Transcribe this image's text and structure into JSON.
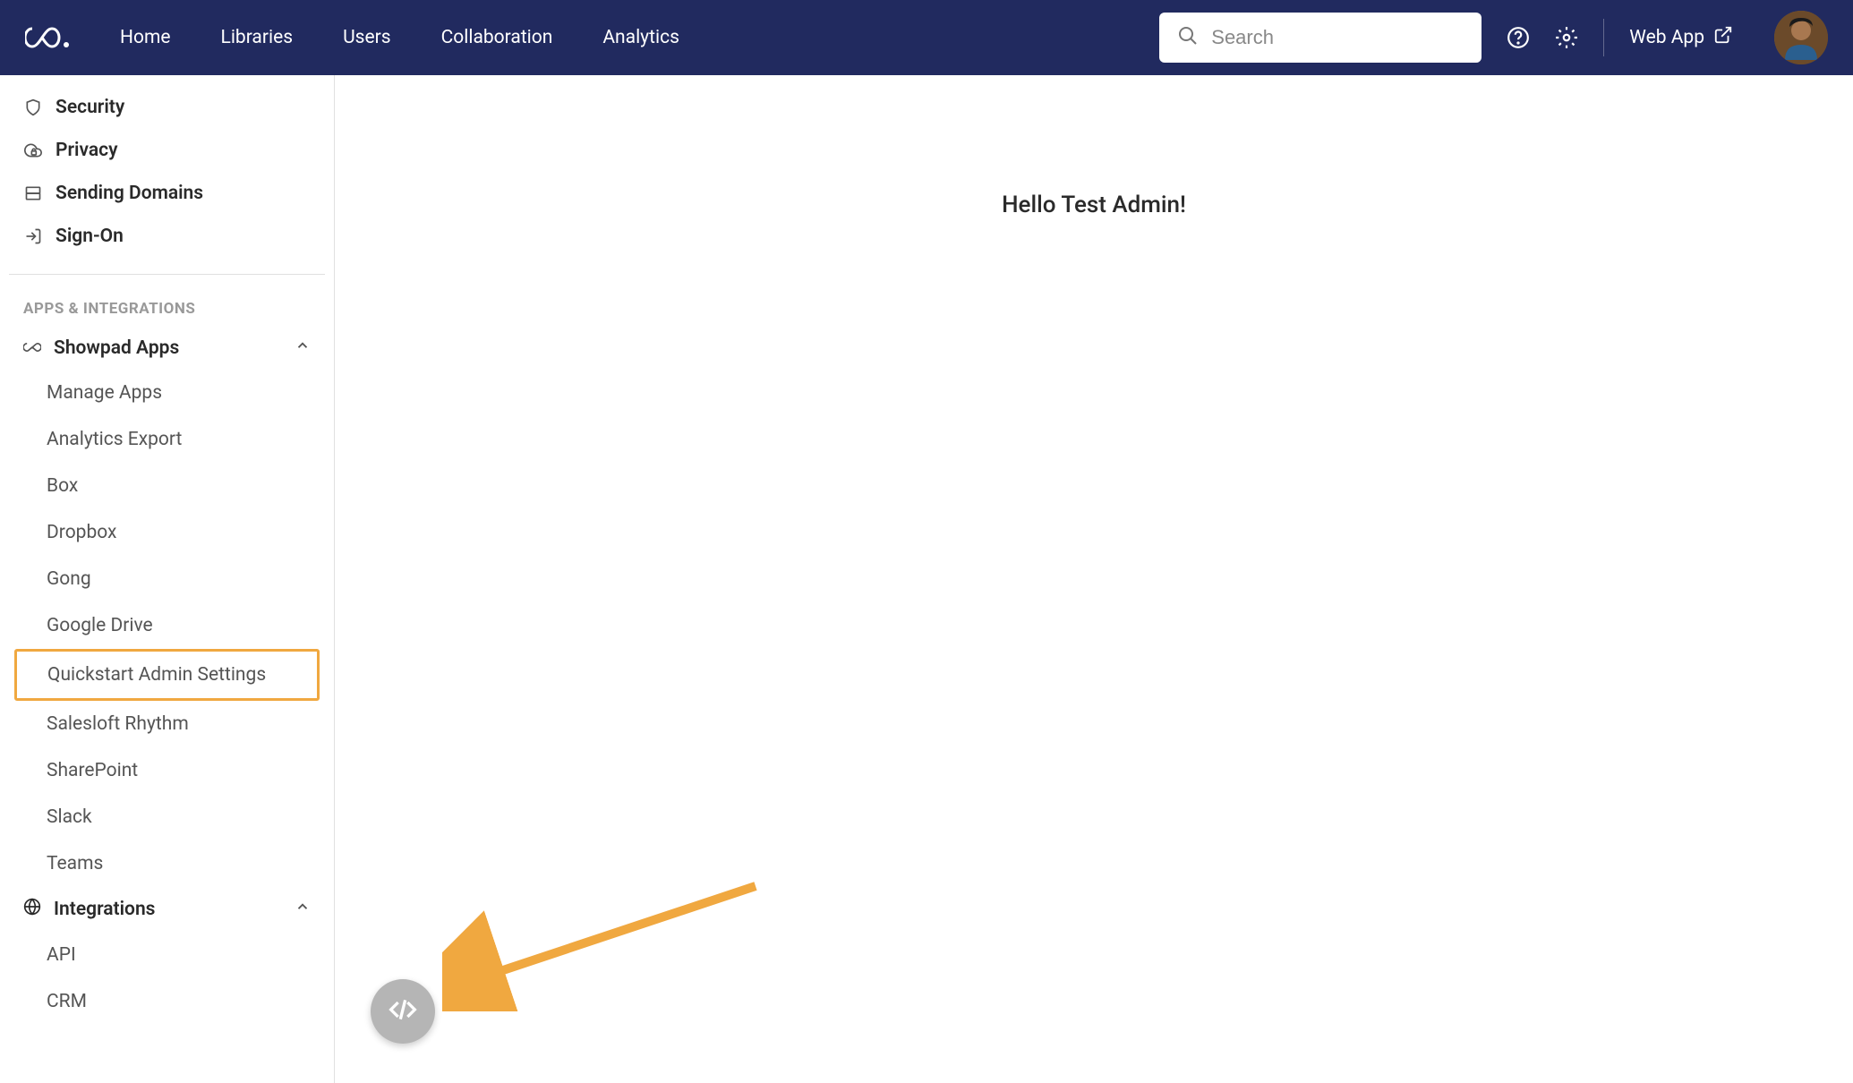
{
  "topnav": {
    "links": [
      "Home",
      "Libraries",
      "Users",
      "Collaboration",
      "Analytics"
    ],
    "search_placeholder": "Search",
    "web_app_label": "Web App"
  },
  "sidebar": {
    "top_items": [
      {
        "icon": "shield",
        "label": "Security"
      },
      {
        "icon": "cloud-lock",
        "label": "Privacy"
      },
      {
        "icon": "server",
        "label": "Sending Domains"
      },
      {
        "icon": "sign-in",
        "label": "Sign-On"
      }
    ],
    "section_header": "APPS & INTEGRATIONS",
    "showpad_apps_label": "Showpad Apps",
    "showpad_apps_items": [
      "Manage Apps",
      "Analytics Export",
      "Box",
      "Dropbox",
      "Gong",
      "Google Drive",
      "Quickstart Admin Settings",
      "Salesloft Rhythm",
      "SharePoint",
      "Slack",
      "Teams"
    ],
    "highlighted_index": 6,
    "integrations_label": "Integrations",
    "integrations_items": [
      "API",
      "CRM"
    ]
  },
  "main": {
    "welcome_text": "Hello Test Admin!"
  }
}
